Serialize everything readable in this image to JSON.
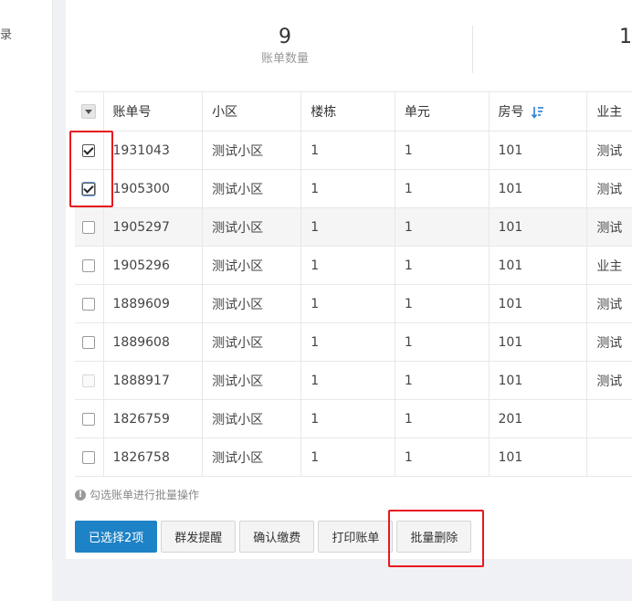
{
  "nav": {
    "partial_text": "录"
  },
  "stats": [
    {
      "value": "9",
      "label": "账单数量"
    },
    {
      "value": "1",
      "label": ""
    }
  ],
  "table": {
    "headers": [
      "账单号",
      "小区",
      "楼栋",
      "单元",
      "房号",
      "业主"
    ],
    "rows": [
      {
        "checked": true,
        "state": "checked",
        "cells": [
          "1931043",
          "测试小区",
          "1",
          "1",
          "101",
          "测试"
        ]
      },
      {
        "checked": true,
        "state": "checked-focus",
        "cells": [
          "1905300",
          "测试小区",
          "1",
          "1",
          "101",
          "测试"
        ]
      },
      {
        "checked": false,
        "state": "hover",
        "cells": [
          "1905297",
          "测试小区",
          "1",
          "1",
          "101",
          "测试"
        ]
      },
      {
        "checked": false,
        "state": "normal",
        "cells": [
          "1905296",
          "测试小区",
          "1",
          "1",
          "101",
          "业主"
        ]
      },
      {
        "checked": false,
        "state": "normal",
        "cells": [
          "1889609",
          "测试小区",
          "1",
          "1",
          "101",
          "测试"
        ]
      },
      {
        "checked": false,
        "state": "normal",
        "cells": [
          "1889608",
          "测试小区",
          "1",
          "1",
          "101",
          "测试"
        ]
      },
      {
        "checked": false,
        "state": "disabled",
        "cells": [
          "1888917",
          "测试小区",
          "1",
          "1",
          "101",
          "测试"
        ]
      },
      {
        "checked": false,
        "state": "normal",
        "cells": [
          "1826759",
          "测试小区",
          "1",
          "1",
          "201",
          ""
        ]
      },
      {
        "checked": false,
        "state": "normal",
        "cells": [
          "1826758",
          "测试小区",
          "1",
          "1",
          "101",
          ""
        ]
      }
    ]
  },
  "hint": "勾选账单进行批量操作",
  "buttons": {
    "selected": "已选择2项",
    "remind": "群发提醒",
    "confirm_pay": "确认缴费",
    "print": "打印账单",
    "batch_delete": "批量删除"
  },
  "colors": {
    "primary": "#1e82c6",
    "highlight": "#e8181e",
    "sort_icon": "#2f7fd3"
  }
}
